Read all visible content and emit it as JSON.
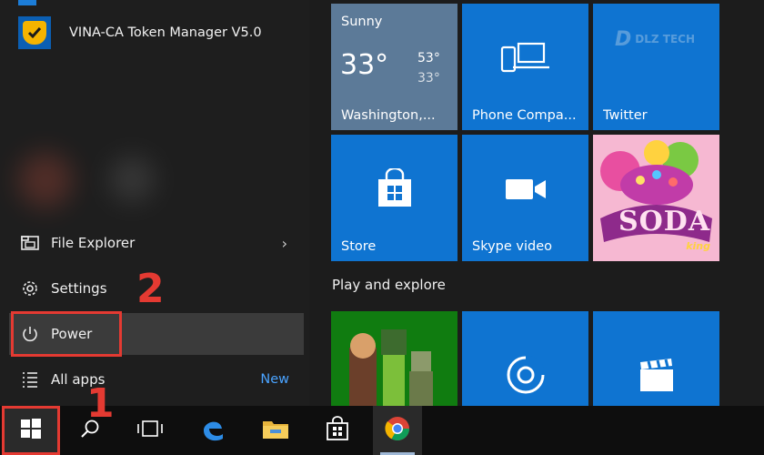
{
  "start_menu": {
    "recent_app": {
      "label": "VINA-CA Token Manager V5.0",
      "icon": "vina-ca-shield-icon"
    },
    "left_items": [
      {
        "id": "file-explorer",
        "label": "File Explorer",
        "icon": "folder-icon",
        "has_submenu": true
      },
      {
        "id": "settings",
        "label": "Settings",
        "icon": "gear-icon"
      },
      {
        "id": "power",
        "label": "Power",
        "icon": "power-icon"
      },
      {
        "id": "all-apps",
        "label": "All apps",
        "icon": "list-icon",
        "badge": "New"
      }
    ]
  },
  "tiles": {
    "weather": {
      "condition": "Sunny",
      "temp": "33°",
      "high": "53°",
      "low": "33°",
      "location": "Washington,..."
    },
    "phone_companion": {
      "label": "Phone Compa..."
    },
    "twitter": {
      "label": "Twitter"
    },
    "store": {
      "label": "Store"
    },
    "skype_video": {
      "label": "Skype video"
    },
    "candy_crush": {
      "label": "SODA",
      "sub": "king"
    },
    "section_title": "Play and explore"
  },
  "callouts": {
    "step1": "1",
    "step2": "2"
  },
  "watermark": {
    "mark": "D",
    "text": "DLZ TECH"
  },
  "colors": {
    "tile_blue": "#0f74d1",
    "weather_tile": "#5c7a98",
    "xbox_green": "#107c10",
    "callout_red": "#e43a32",
    "accent_link": "#4aa3ff"
  },
  "taskbar": {
    "items": [
      {
        "id": "start",
        "icon": "windows-logo-icon"
      },
      {
        "id": "search",
        "icon": "search-icon"
      },
      {
        "id": "task-view",
        "icon": "task-view-icon"
      },
      {
        "id": "edge",
        "icon": "edge-icon"
      },
      {
        "id": "file-explorer",
        "icon": "folder-icon"
      },
      {
        "id": "store",
        "icon": "store-bag-icon"
      },
      {
        "id": "chrome",
        "icon": "chrome-icon"
      }
    ]
  }
}
